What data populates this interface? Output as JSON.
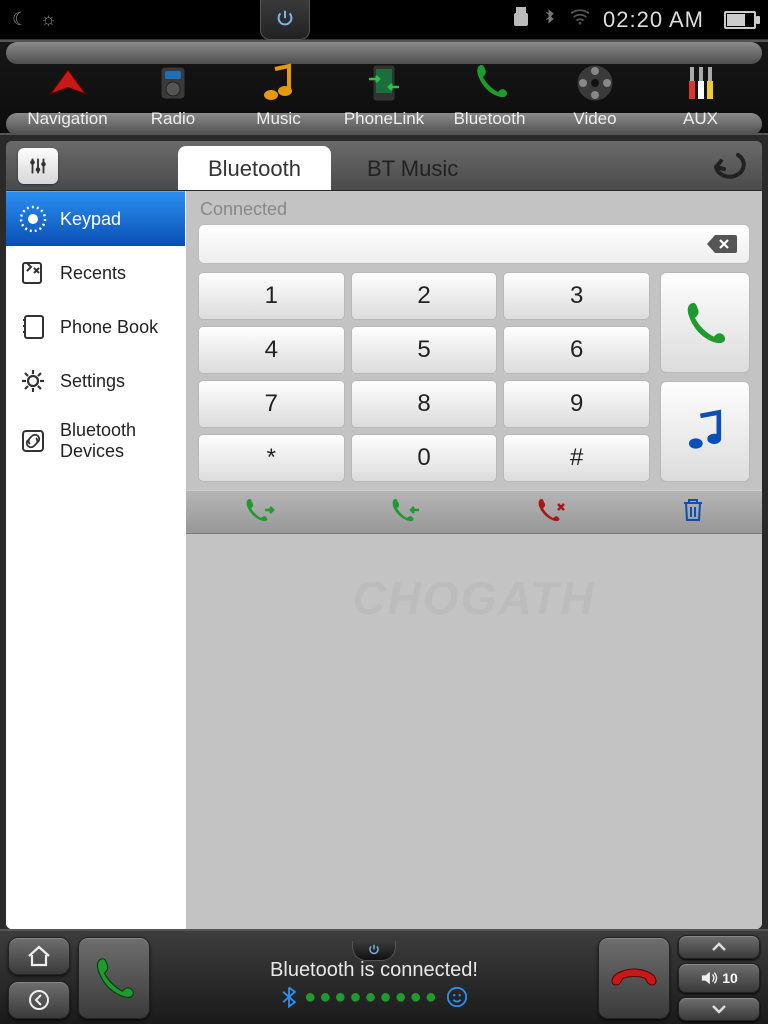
{
  "statusbar": {
    "time": "02:20 AM"
  },
  "topnav": {
    "items": [
      {
        "label": "Navigation"
      },
      {
        "label": "Radio"
      },
      {
        "label": "Music"
      },
      {
        "label": "PhoneLink"
      },
      {
        "label": "Bluetooth"
      },
      {
        "label": "Video"
      },
      {
        "label": "AUX"
      }
    ]
  },
  "tabs": {
    "bluetooth": "Bluetooth",
    "btmusic": "BT Music"
  },
  "sidebar": {
    "items": [
      {
        "label": "Keypad"
      },
      {
        "label": "Recents"
      },
      {
        "label": "Phone Book"
      },
      {
        "label": "Settings"
      },
      {
        "label": "Bluetooth Devices"
      }
    ]
  },
  "keypad": {
    "status": "Connected",
    "keys": [
      "1",
      "2",
      "3",
      "4",
      "5",
      "6",
      "7",
      "8",
      "9",
      "*",
      "0",
      "#"
    ]
  },
  "watermark": "CHOGATH",
  "dock": {
    "status": "Bluetooth is connected!",
    "volume": "10"
  }
}
